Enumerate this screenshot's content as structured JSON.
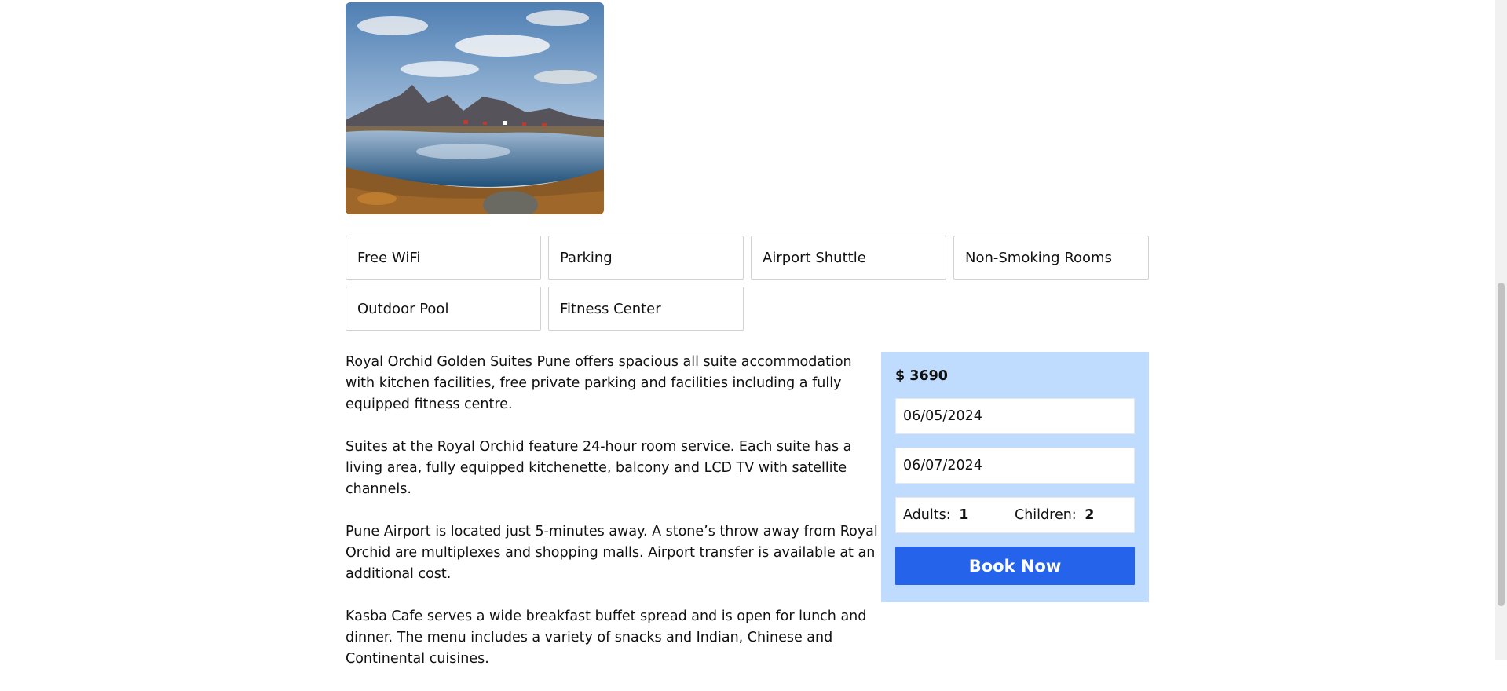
{
  "photo": {
    "icon": "landscape-photo"
  },
  "amenities": [
    "Free WiFi",
    "Parking",
    "Airport Shuttle",
    "Non-Smoking Rooms",
    "Outdoor Pool",
    "Fitness Center"
  ],
  "description": [
    "Royal Orchid Golden Suites Pune offers spacious all suite accommodation with kitchen facilities, free private parking and facilities including a fully equipped fitness centre.",
    "Suites at the Royal Orchid feature 24-hour room service. Each suite has a living area, fully equipped kitchenette, balcony and LCD TV with satellite channels.",
    "Pune Airport is located just 5-minutes away. A stone’s throw away from Royal Orchid are multiplexes and shopping malls. Airport transfer is available at an additional cost.",
    "Kasba Cafe serves a wide breakfast buffet spread and is open for lunch and dinner. The menu includes a variety of snacks and Indian, Chinese and Continental cuisines."
  ],
  "booking": {
    "price": "$ 3690",
    "check_in": "06/05/2024",
    "check_out": "06/07/2024",
    "adults_label": "Adults:",
    "adults_value": "1",
    "children_label": "Children:",
    "children_value": "2",
    "book_label": "Book Now"
  },
  "colors": {
    "booking_bg": "#bfdbfe",
    "button_bg": "#2563eb"
  }
}
